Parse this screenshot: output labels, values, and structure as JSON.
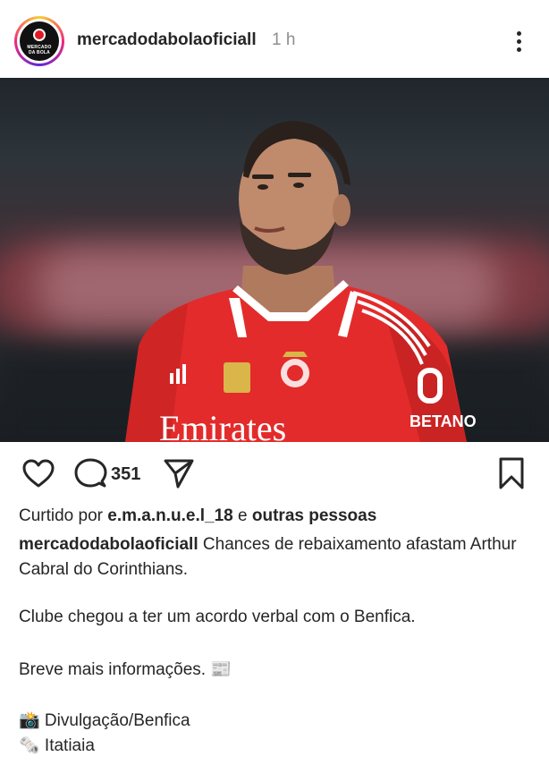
{
  "post": {
    "username": "mercadodabolaoficiall",
    "time": "1 h",
    "avatar_text": "MERCADO DA BOLA",
    "comments_count": "351",
    "likes_prefix": "Curtido por",
    "liked_user": "e.m.a.n.u.e.l_18",
    "likes_joiner": "e",
    "likes_others": "outras pessoas",
    "caption_user": "mercadodabolaoficiall",
    "caption_text": "Chances de rebaixamento afastam Arthur Cabral do Corinthians.",
    "paragraph2": "Clube chegou a ter um acordo verbal com o Benfica.",
    "paragraph3": "Breve mais informações. 📰",
    "credit_photo": "📸 Divulgação/Benfica",
    "credit_source": "🗞️ Itatiaia"
  },
  "photo": {
    "shirt_sponsor": "Emirates",
    "sleeve_sponsor": "BETANO",
    "kit_color": "#e32b2b",
    "kit_dark": "#b51d1d"
  },
  "icons": {
    "more": "more-options-icon",
    "like": "heart-icon",
    "comment": "comment-bubble-icon",
    "share": "send-paper-plane-icon",
    "save": "bookmark-icon"
  }
}
